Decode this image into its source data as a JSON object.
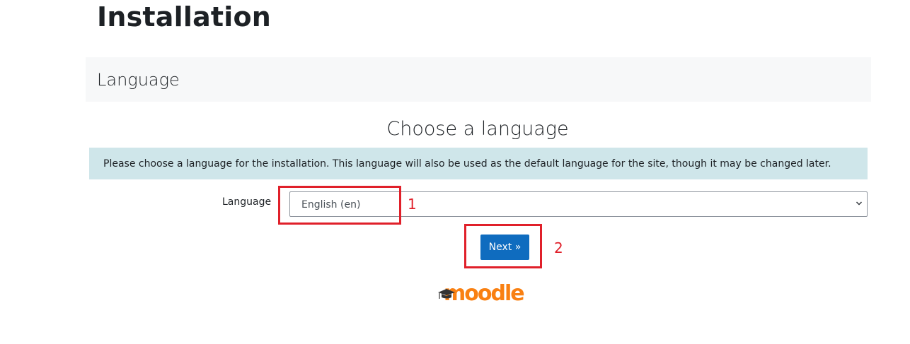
{
  "page": {
    "title": "Installation"
  },
  "section": {
    "title": "Language"
  },
  "main": {
    "heading": "Choose a language",
    "info": "Please choose a language for the installation. This language will also be used as the default language for the site, though it may be changed later."
  },
  "form": {
    "language_label": "Language",
    "language_selected": "English (en)",
    "next_label": "Next »"
  },
  "annotations": {
    "one": "1",
    "two": "2",
    "color": "#e0202a"
  },
  "logo": {
    "text": "moodle",
    "color": "#f98012"
  },
  "colors": {
    "accent": "#0f6cbf",
    "info_bg": "#cfe6ea",
    "section_bg": "#f7f8f9"
  },
  "icons": {
    "select_chevron": "chevron-down-icon",
    "logo_cap": "graduation-cap-icon"
  }
}
